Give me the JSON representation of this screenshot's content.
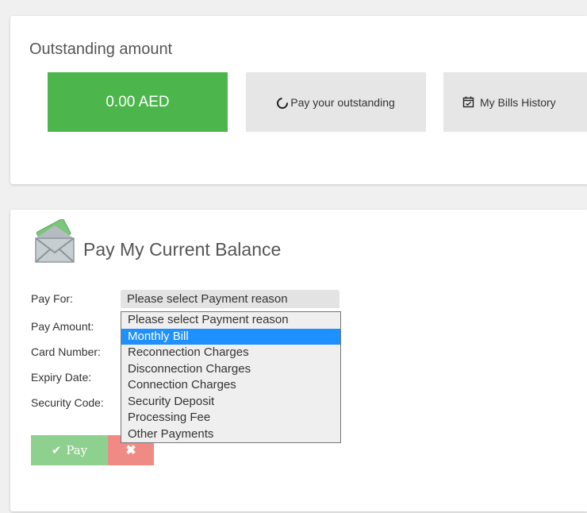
{
  "outstanding": {
    "title": "Outstanding amount",
    "amount": "0.00 AED",
    "pay_label": "Pay your outstanding",
    "history_label": "My Bills History"
  },
  "payment": {
    "title": "Pay My Current Balance",
    "labels": {
      "pay_for": "Pay For:",
      "pay_amount": "Pay Amount:",
      "card_number": "Card Number:",
      "expiry_date": "Expiry Date:",
      "security_code": "Security Code:"
    },
    "select_value": "Please select Payment reason",
    "options": [
      "Please select Payment reason",
      "Monthly Bill",
      "Reconnection Charges",
      "Disconnection Charges",
      "Connection Charges",
      "Security Deposit",
      "Processing Fee",
      "Other Payments"
    ],
    "highlighted_option": "Monthly Bill",
    "pay_button": "Pay",
    "cancel_button": "✖"
  },
  "colors": {
    "amount_bg": "#4cb54c",
    "tile_bg": "#e6e6e6",
    "highlight": "#1e90ff",
    "pay_button": "#8ed08e",
    "cancel_button": "#f08a84"
  }
}
